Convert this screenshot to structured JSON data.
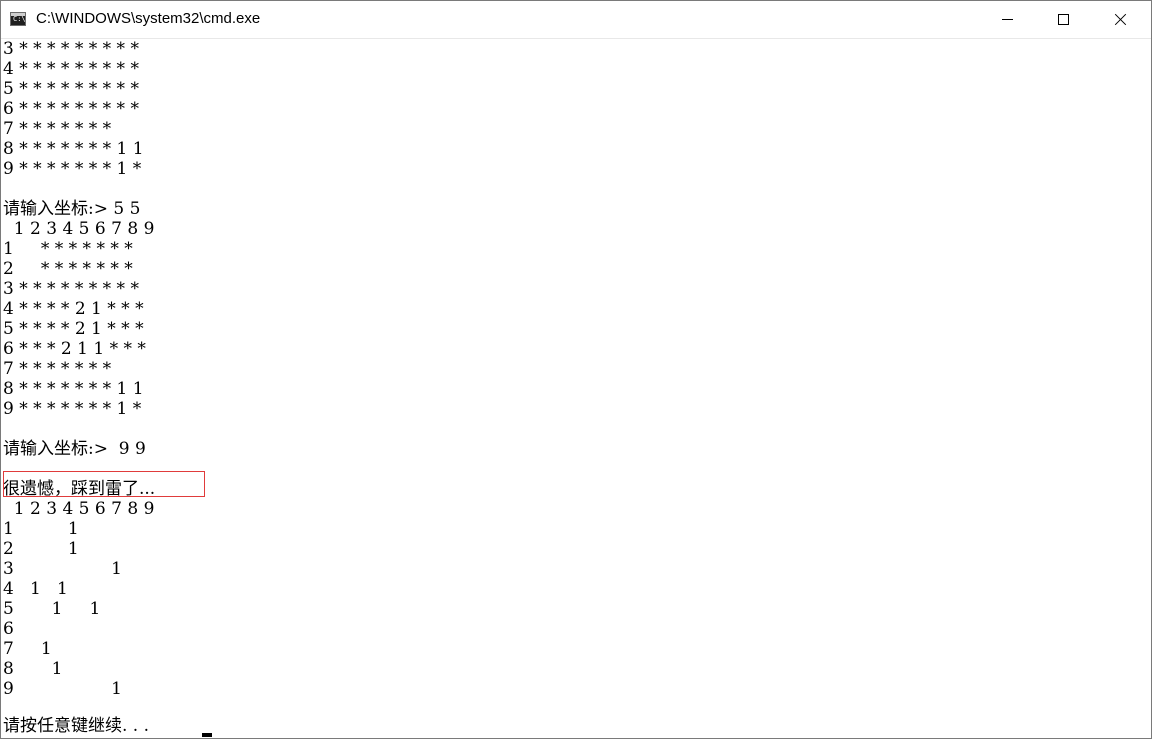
{
  "window": {
    "title": "C:\\WINDOWS\\system32\\cmd.exe",
    "icon": "cmd-icon"
  },
  "console": {
    "lines": [
      "3 * * * * * * * * *",
      "4 * * * * * * * * *",
      "5 * * * * * * * * *",
      "6 * * * * * * * * *",
      "7 * * * * * * *",
      "8 * * * * * * * 1 1",
      "9 * * * * * * * 1 *",
      "",
      "请输入坐标:> 5 5",
      "  1 2 3 4 5 6 7 8 9",
      "1     * * * * * * *",
      "2     * * * * * * *",
      "3 * * * * * * * * *",
      "4 * * * * 2 1 * * *",
      "5 * * * * 2 1 * * *",
      "6 * * * 2 1 1 * * *",
      "7 * * * * * * *",
      "8 * * * * * * * 1 1",
      "9 * * * * * * * 1 *",
      "",
      "请输入坐标:>  9 9",
      "",
      "很遗憾，踩到雷了...",
      "  1 2 3 4 5 6 7 8 9",
      "1          1",
      "2          1",
      "3                  1",
      "4   1   1",
      "5       1     1",
      "6",
      "7     1",
      "8       1",
      "9                  1",
      "",
      "请按任意键继续. . . "
    ]
  }
}
